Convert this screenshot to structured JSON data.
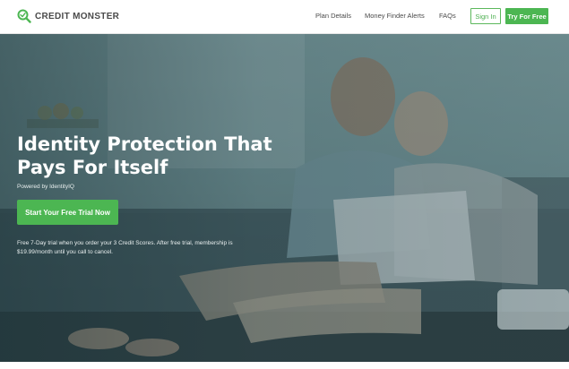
{
  "brand": {
    "name": "CREDIT MONSTER",
    "logo_icon": "magnifier-check-icon",
    "accent_color": "#4cb652"
  },
  "nav": {
    "links": [
      {
        "label": "Plan Details"
      },
      {
        "label": "Money Finder Alerts"
      },
      {
        "label": "FAQs"
      }
    ],
    "sign_in_label": "Sign In",
    "try_free_label": "Try For Free"
  },
  "hero": {
    "title_line1": "Identity Protection That",
    "title_line2": "Pays For Itself",
    "powered_by": "Powered by IdentityIQ",
    "cta_label": "Start Your Free Trial Now",
    "disclaimer_line1": "Free 7-Day trial when you order your 3 Credit Scores. After free trial, membership is",
    "disclaimer_line2": "$19.99/month until you call to cancel."
  }
}
